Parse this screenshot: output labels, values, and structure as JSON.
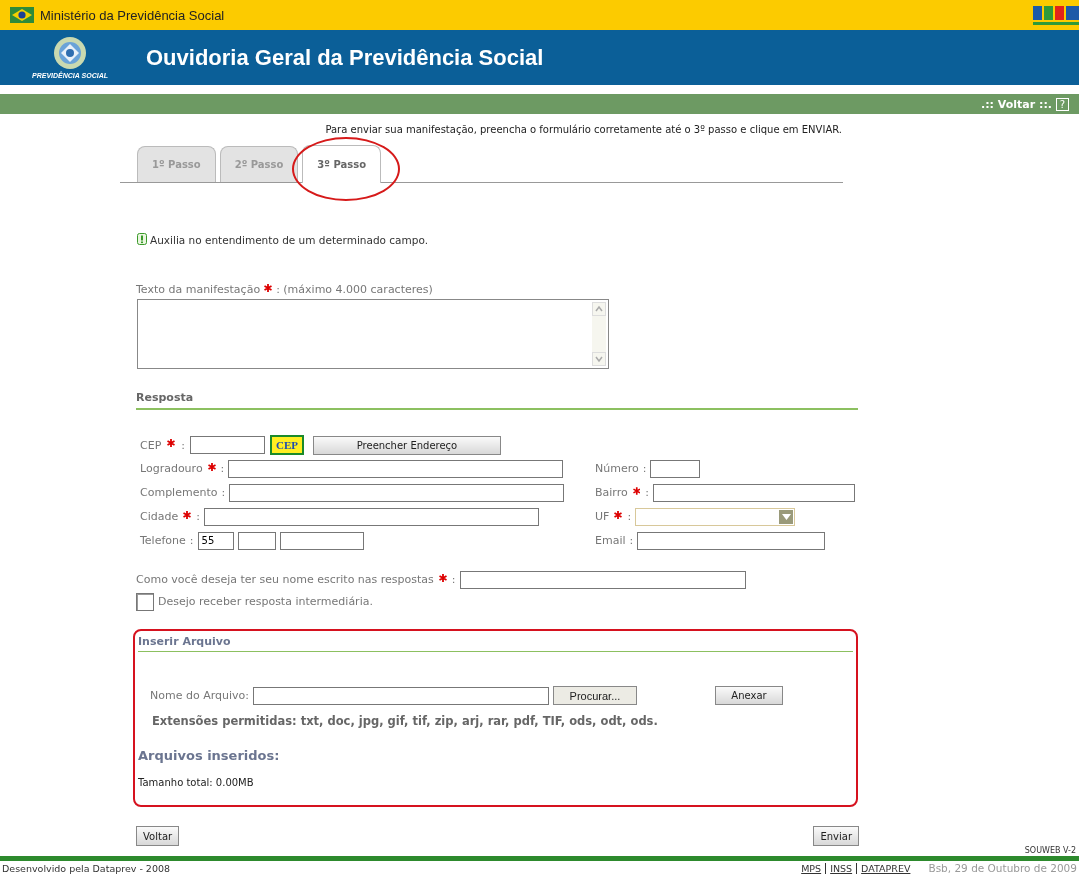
{
  "top_bar": {
    "title": "Ministério da Previdência Social"
  },
  "header": {
    "title": "Ouvidoria Geral da Previdência Social",
    "logo_text": "PREVIDÊNCIA SOCIAL"
  },
  "nav_bar": {
    "link": ".:: Voltar ::.",
    "help": "?"
  },
  "intro": "Para enviar sua manifestação, preencha o formulário corretamente até o 3º passo e clique em ENVIAR.",
  "tabs": [
    {
      "label": "1º Passo",
      "selected": false,
      "highlighted": false
    },
    {
      "label": "2º Passo",
      "selected": false,
      "highlighted": false
    },
    {
      "label": "3º Passo",
      "selected": true,
      "highlighted": true
    }
  ],
  "hint": "Auxilia no entendimento de um determinado campo.",
  "message": {
    "label": "Texto da manifestação",
    "required": true,
    "suffix": ": (máximo 4.000 caracteres)"
  },
  "response": {
    "title": "Resposta",
    "cep": {
      "label": "CEP",
      "required": true,
      "suffix": ":",
      "lookup": "CEP",
      "fill_button": "Preencher Endereço"
    },
    "left_fields": [
      {
        "label": "Logradouro",
        "required": true,
        "suffix": ":"
      },
      {
        "label": "Complemento",
        "required": false,
        "suffix": ":"
      },
      {
        "label": "Cidade",
        "required": true,
        "suffix": ":"
      },
      {
        "label": "Telefone",
        "required": false,
        "suffix": ":",
        "kind": "phone",
        "value": "55"
      }
    ],
    "right_fields": [
      {
        "label": "Número",
        "required": false,
        "suffix": ":"
      },
      {
        "label": "Bairro",
        "required": true,
        "suffix": ":"
      },
      {
        "label": "UF",
        "required": true,
        "suffix": ":",
        "kind": "select"
      },
      {
        "label": "Email",
        "required": false,
        "suffix": ":"
      }
    ],
    "name_question": {
      "label": "Como você deseja ter seu nome escrito nas respostas",
      "required": true,
      "suffix": ":"
    },
    "intermediate": {
      "label": "Desejo receber resposta intermediária.",
      "checked": false
    }
  },
  "files": {
    "title": "Inserir Arquivo",
    "highlighted": true,
    "file_label": "Nome do Arquivo:",
    "browse": "Procurar...",
    "attach": "Anexar",
    "extensions": "Extensões permitidas: txt, doc, jpg, gif, tif, zip, arj, rar, pdf, TIF, ods, odt, ods.",
    "inserted_title": "Arquivos inseridos:",
    "total": "Tamanho total: 0.00MB"
  },
  "buttons": {
    "back": "Voltar",
    "send": "Enviar"
  },
  "footer": {
    "version": "SOUWEB V-2",
    "credit": "Desenvolvido pela Dataprev - 2008",
    "links": [
      "MPS",
      "INSS",
      "DATAPREV"
    ],
    "date": "Bsb, 29 de Outubro de 2009"
  }
}
